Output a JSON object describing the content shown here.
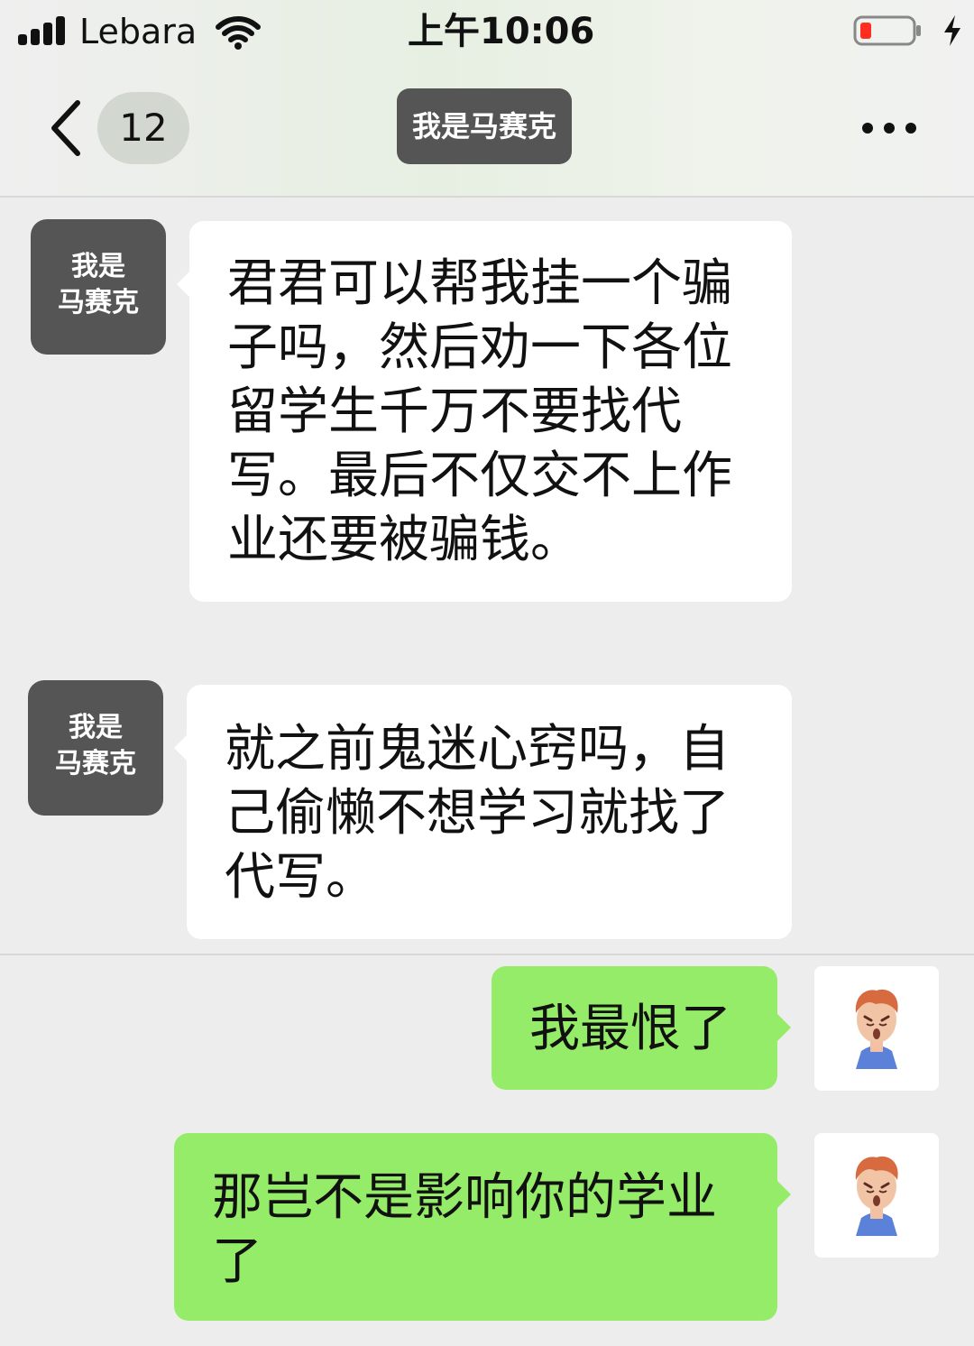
{
  "status": {
    "carrier": "Lebara",
    "time": "上午10:06"
  },
  "nav": {
    "unread_count": "12",
    "title": "我是马赛克"
  },
  "messages": [
    {
      "direction": "incoming",
      "avatar_label_line1": "我是",
      "avatar_label_line2": "马赛克",
      "text": "君君可以帮我挂一个骗子吗，然后劝一下各位留学生千万不要找代写。最后不仅交不上作业还要被骗钱。"
    },
    {
      "direction": "incoming",
      "avatar_label_line1": "我是",
      "avatar_label_line2": "马赛克",
      "text": "就之前鬼迷心窍吗，自己偷懒不想学习就找了代写。"
    },
    {
      "direction": "outgoing",
      "text": "我最恨了"
    },
    {
      "direction": "outgoing",
      "text": "那岂不是影响你的学业了"
    }
  ],
  "colors": {
    "outgoing_bubble": "#95ec69",
    "incoming_bubble": "#ffffff",
    "background": "#ededed",
    "title_box": "#555555"
  },
  "icons": {
    "back": "chevron-left-icon",
    "more": "more-dots-icon",
    "wifi": "wifi-icon",
    "signal": "signal-icon",
    "battery": "battery-low-icon",
    "charging": "charging-bolt-icon"
  }
}
